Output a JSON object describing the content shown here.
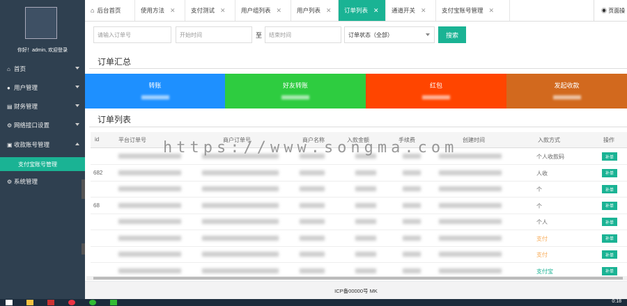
{
  "sidebar": {
    "welcome": "你好！admin, 欢迎登录",
    "items": [
      {
        "label": "首页",
        "icon": "home-icon",
        "glyph": "⌂"
      },
      {
        "label": "用户管理",
        "icon": "user-icon",
        "glyph": "●"
      },
      {
        "label": "财务管理",
        "icon": "finance-icon",
        "glyph": "▤"
      },
      {
        "label": "网络接口设置",
        "icon": "gear-icon",
        "glyph": "⚙"
      },
      {
        "label": "收款账号管理",
        "icon": "wallet-icon",
        "glyph": "▣"
      },
      {
        "label": "系统管理",
        "icon": "gear-icon",
        "glyph": "⚙"
      }
    ],
    "active_sub": "支付宝账号管理"
  },
  "tabs": [
    {
      "label": "后台首页",
      "closable": false
    },
    {
      "label": "使用方法",
      "closable": true
    },
    {
      "label": "支付测试",
      "closable": true
    },
    {
      "label": "用户组列表",
      "closable": true
    },
    {
      "label": "用户列表",
      "closable": true
    },
    {
      "label": "订单列表",
      "closable": true,
      "active": true
    },
    {
      "label": "通道开关",
      "closable": true
    },
    {
      "label": "支付宝账号管理",
      "closable": true
    }
  ],
  "tab_close_glyph": "✕",
  "tab_right_label": "◉ 页面操",
  "filters": {
    "order_placeholder": "请输入订单号",
    "start_placeholder": "开始时间",
    "range_sep": "至",
    "end_placeholder": "结束时间",
    "status_selected": "订单状态（全部）",
    "search_label": "搜索"
  },
  "summary": {
    "title": "订单汇总",
    "cards": [
      {
        "label": "转账",
        "color": "#1e90ff"
      },
      {
        "label": "好友转账",
        "color": "#2ecc40"
      },
      {
        "label": "红包",
        "color": "#ff4500"
      },
      {
        "label": "发起收款",
        "color": "#d2691e"
      }
    ]
  },
  "orders": {
    "title": "订单列表",
    "columns": [
      "id",
      "平台订单号",
      "商户订单号",
      "商户名称",
      "入款金额",
      "手续费",
      "创建时间",
      "入款方式",
      "操作"
    ],
    "rows": [
      {
        "id": "",
        "pay_method": "个人收款码",
        "action": "补单",
        "method_color": "gray"
      },
      {
        "id": "682",
        "pay_method": "人收",
        "action": "补单",
        "method_color": "gray"
      },
      {
        "id": "",
        "pay_method": "个",
        "action": "补单",
        "method_color": "gray"
      },
      {
        "id": "68",
        "pay_method": "个",
        "action": "补单",
        "method_color": "gray"
      },
      {
        "id": "",
        "pay_method": "个人",
        "action": "补单",
        "method_color": "gray"
      },
      {
        "id": "",
        "pay_method": "支付",
        "action": "补单",
        "method_color": "orange"
      },
      {
        "id": "",
        "pay_method": "支付",
        "action": "补单",
        "method_color": "orange"
      },
      {
        "id": "",
        "pay_method": "支付宝",
        "action": "补单",
        "method_color": "green"
      }
    ]
  },
  "watermark": "https://www.songma.com",
  "footer": "ICP备00000号 MK",
  "clock": "0:18"
}
